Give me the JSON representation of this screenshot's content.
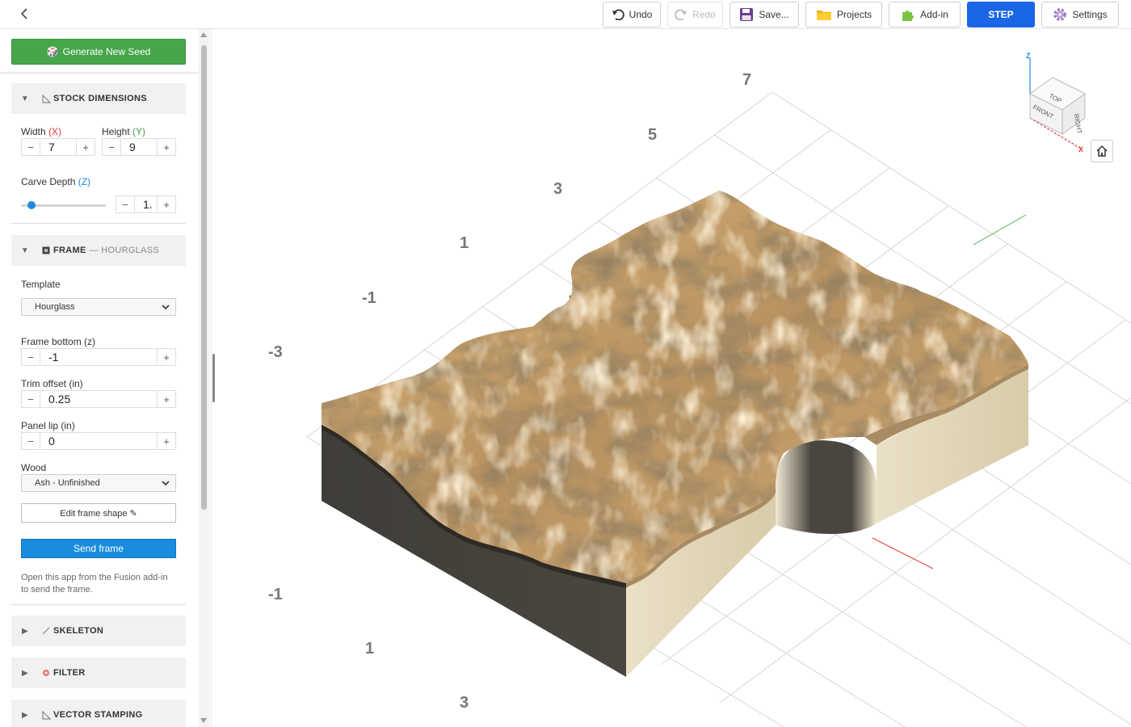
{
  "toolbar": {
    "undo": "Undo",
    "redo": "Redo",
    "save": "Save...",
    "projects": "Projects",
    "addin": "Add-in",
    "step": "STEP",
    "settings": "Settings"
  },
  "sidebar": {
    "seed_button": "Generate New Seed",
    "stock": {
      "title": "STOCK DIMENSIONS",
      "width_label": "Width",
      "width_axis": "(X)",
      "width_value": "7",
      "height_label": "Height",
      "height_axis": "(Y)",
      "height_value": "9",
      "depth_label": "Carve Depth",
      "depth_axis": "(Z)",
      "depth_value": "1.",
      "depth_slider_fraction": 0.12
    },
    "frame": {
      "title": "FRAME",
      "subtitle": "— HOURGLASS",
      "template_label": "Template",
      "template_value": "Hourglass",
      "bottom_label": "Frame bottom (z)",
      "bottom_value": "-1",
      "trim_label": "Trim offset (in)",
      "trim_value": "0.25",
      "lip_label": "Panel lip (in)",
      "lip_value": "0",
      "wood_label": "Wood",
      "wood_value": "Ash - Unfinished",
      "edit_button": "Edit frame shape ✎",
      "send_button": "Send frame",
      "note": "Open this app from the Fusion add-in to send the frame."
    },
    "sections": [
      "SKELETON",
      "FILTER",
      "VECTOR STAMPING"
    ]
  },
  "viewport": {
    "axis_numbers_top": [
      "7",
      "5",
      "3",
      "1",
      "-1",
      "-3"
    ],
    "axis_numbers_bottom": [
      "-1",
      "1",
      "3"
    ],
    "viewcube": {
      "top": "TOP",
      "front": "FRONT",
      "right": "RIGHT",
      "z": "Z",
      "x": "X"
    },
    "colors": {
      "terrain_light": "#e8c994",
      "terrain_dark": "#4a3b26",
      "side_dark": "#45423c",
      "side_light": "#e6dcc2"
    }
  }
}
